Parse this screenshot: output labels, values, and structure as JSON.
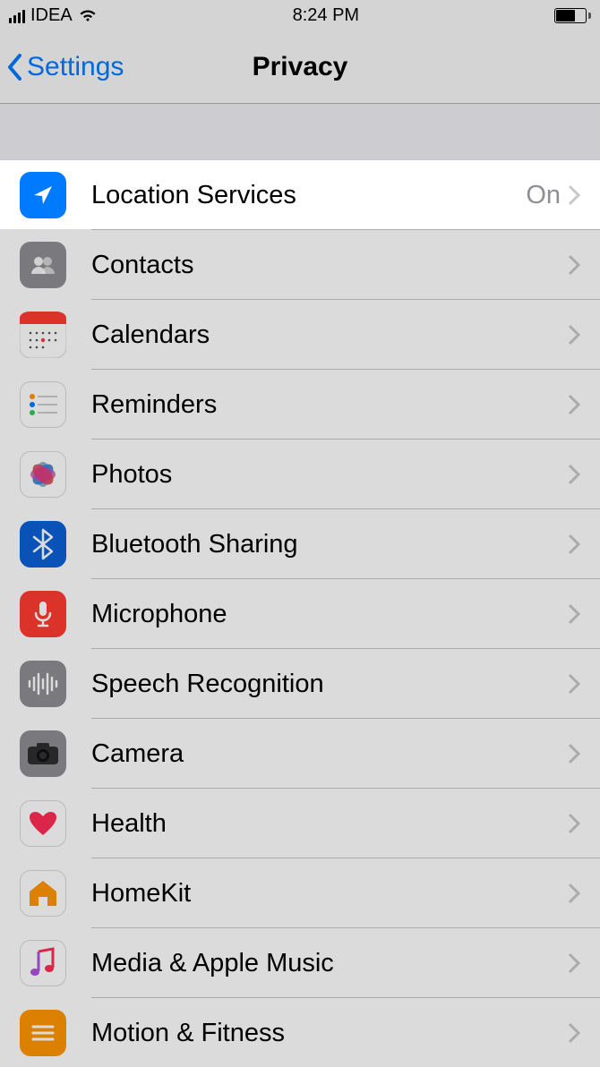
{
  "status": {
    "carrier": "IDEA",
    "time": "8:24 PM"
  },
  "nav": {
    "back": "Settings",
    "title": "Privacy"
  },
  "rows": [
    {
      "label": "Location Services",
      "value": "On",
      "iconName": "location-arrow-icon",
      "highlight": true
    },
    {
      "label": "Contacts",
      "value": "",
      "iconName": "contacts-icon"
    },
    {
      "label": "Calendars",
      "value": "",
      "iconName": "calendar-icon"
    },
    {
      "label": "Reminders",
      "value": "",
      "iconName": "reminders-icon"
    },
    {
      "label": "Photos",
      "value": "",
      "iconName": "photos-icon"
    },
    {
      "label": "Bluetooth Sharing",
      "value": "",
      "iconName": "bluetooth-icon"
    },
    {
      "label": "Microphone",
      "value": "",
      "iconName": "microphone-icon"
    },
    {
      "label": "Speech Recognition",
      "value": "",
      "iconName": "waveform-icon"
    },
    {
      "label": "Camera",
      "value": "",
      "iconName": "camera-icon"
    },
    {
      "label": "Health",
      "value": "",
      "iconName": "heart-icon"
    },
    {
      "label": "HomeKit",
      "value": "",
      "iconName": "house-icon"
    },
    {
      "label": "Media & Apple Music",
      "value": "",
      "iconName": "music-note-icon"
    },
    {
      "label": "Motion & Fitness",
      "value": "",
      "iconName": "motion-icon"
    }
  ]
}
